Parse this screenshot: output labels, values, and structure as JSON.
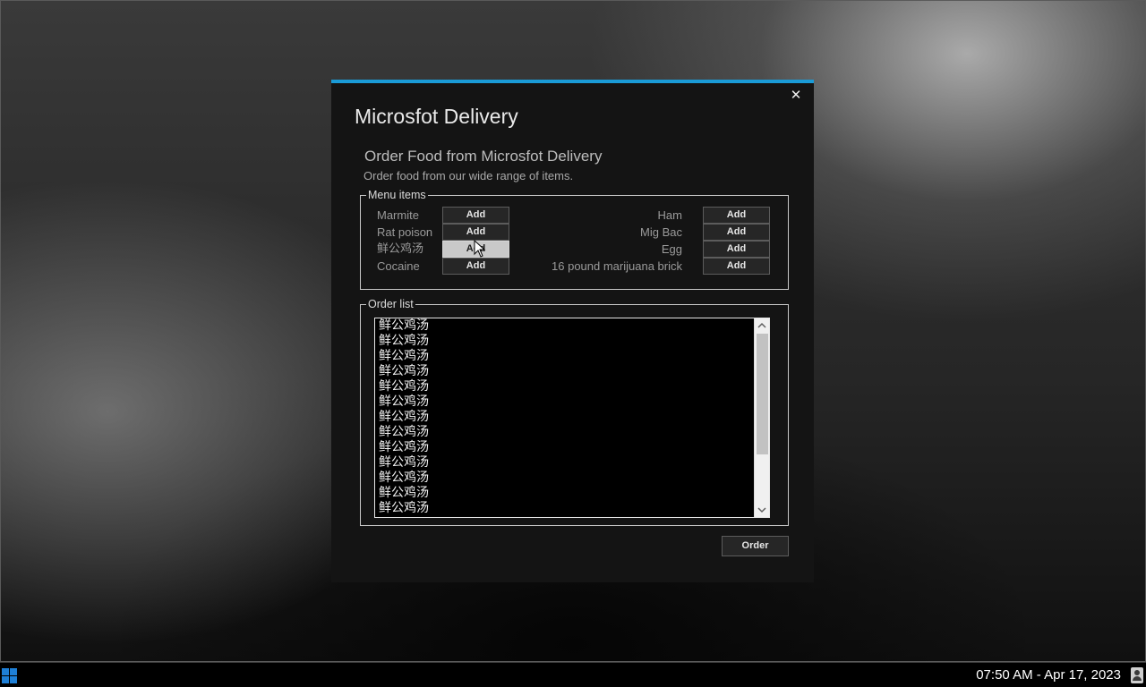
{
  "window": {
    "app_title": "Microsfot Delivery",
    "heading": "Order Food from Microsfot Delivery",
    "subheading": "Order food from our wide range of items.",
    "close_glyph": "✕"
  },
  "menu": {
    "legend": "Menu items",
    "add_label": "Add",
    "left_items": [
      "Marmite",
      "Rat poison",
      "鲜公鸡汤",
      "Cocaine"
    ],
    "right_items": [
      "Ham",
      "Mig Bac",
      "Egg",
      "16 pound marijuana brick"
    ],
    "hovered_item": "鲜公鸡汤"
  },
  "order": {
    "legend": "Order list",
    "entries": [
      "鲜公鸡汤",
      "鲜公鸡汤",
      "鲜公鸡汤",
      "鲜公鸡汤",
      "鲜公鸡汤",
      "鲜公鸡汤",
      "鲜公鸡汤",
      "鲜公鸡汤",
      "鲜公鸡汤",
      "鲜公鸡汤",
      "鲜公鸡汤",
      "鲜公鸡汤",
      "鲜公鸡汤"
    ],
    "button_label": "Order"
  },
  "taskbar": {
    "clock": "07:50 AM - Apr 17, 2023"
  },
  "icons": {
    "start": "windows-logo-icon",
    "user": "user-icon",
    "close": "close-icon",
    "cursor": "mouse-pointer-icon"
  },
  "colors": {
    "accent": "#1a9bd7",
    "dialog_bg": "#141414",
    "list_bg": "#000000"
  }
}
